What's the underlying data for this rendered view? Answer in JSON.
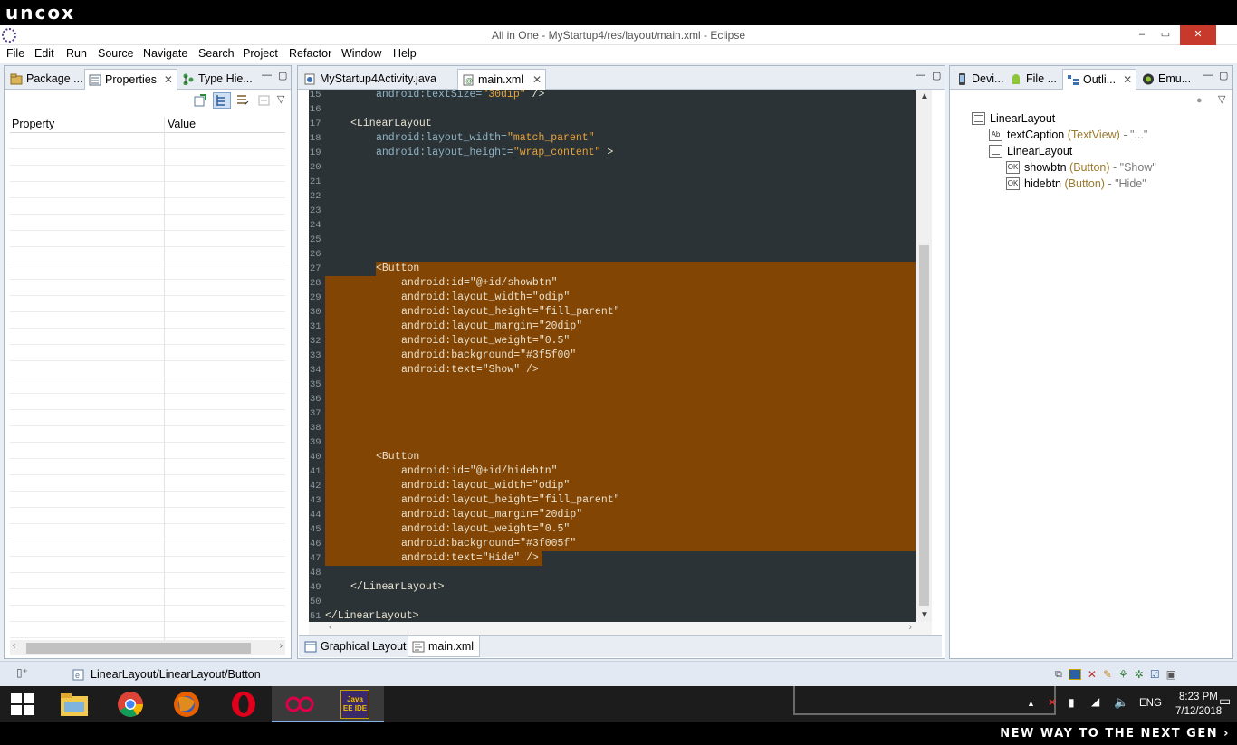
{
  "brand": {
    "logo_text": "uncox",
    "banner": "NEW WAY TO THE NEXT GEN ›"
  },
  "window": {
    "title": "All in One - MyStartup4/res/layout/main.xml - Eclipse",
    "minimize": "–",
    "maximize": "▭",
    "close": "✕"
  },
  "menu": [
    "File",
    "Edit",
    "Run",
    "Source",
    "Navigate",
    "Search",
    "Project",
    "Refactor",
    "Window",
    "Help"
  ],
  "left_panel": {
    "tabs": [
      {
        "label": "Package ...",
        "active": false
      },
      {
        "label": "Properties",
        "active": true
      },
      {
        "label": "Type Hie...",
        "active": false
      }
    ],
    "columns": [
      "Property",
      "Value"
    ]
  },
  "editor": {
    "tabs": [
      {
        "label": "MyStartup4Activity.java",
        "active": false
      },
      {
        "label": "main.xml",
        "active": true
      }
    ],
    "lines": [
      {
        "n": "15",
        "indent": 2,
        "segs": [
          [
            "attr",
            "android:textSize="
          ],
          [
            "str",
            "\"30dip\""
          ],
          [
            "plain",
            " />"
          ]
        ]
      },
      {
        "n": "16",
        "indent": 0,
        "segs": []
      },
      {
        "n": "17",
        "indent": 1,
        "segs": [
          [
            "plain",
            "<LinearLayout"
          ]
        ]
      },
      {
        "n": "18",
        "indent": 2,
        "segs": [
          [
            "attr",
            "android:layout_width="
          ],
          [
            "str",
            "\"match_parent\""
          ]
        ]
      },
      {
        "n": "19",
        "indent": 2,
        "segs": [
          [
            "attr",
            "android:layout_height="
          ],
          [
            "str",
            "\"wrap_content\""
          ],
          [
            "plain",
            " >"
          ]
        ]
      },
      {
        "n": "20",
        "indent": 0,
        "segs": []
      },
      {
        "n": "21",
        "indent": 0,
        "segs": []
      },
      {
        "n": "22",
        "indent": 0,
        "segs": []
      },
      {
        "n": "23",
        "indent": 0,
        "segs": []
      },
      {
        "n": "24",
        "indent": 0,
        "segs": []
      },
      {
        "n": "25",
        "indent": 0,
        "segs": []
      },
      {
        "n": "26",
        "indent": 0,
        "segs": []
      },
      {
        "n": "27",
        "indent": 2,
        "segs": [
          [
            "plain",
            "<Button"
          ]
        ]
      },
      {
        "n": "28",
        "indent": 3,
        "segs": [
          [
            "plain",
            "android:id=\"@+id/showbtn\""
          ]
        ]
      },
      {
        "n": "29",
        "indent": 3,
        "segs": [
          [
            "plain",
            "android:layout_width=\"odip\""
          ]
        ]
      },
      {
        "n": "30",
        "indent": 3,
        "segs": [
          [
            "plain",
            "android:layout_height=\"fill_parent\""
          ]
        ]
      },
      {
        "n": "31",
        "indent": 3,
        "segs": [
          [
            "plain",
            "android:layout_margin=\"20dip\""
          ]
        ]
      },
      {
        "n": "32",
        "indent": 3,
        "segs": [
          [
            "plain",
            "android:layout_weight=\"0.5\""
          ]
        ]
      },
      {
        "n": "33",
        "indent": 3,
        "segs": [
          [
            "plain",
            "android:background=\"#3f5f00\""
          ]
        ]
      },
      {
        "n": "34",
        "indent": 3,
        "segs": [
          [
            "plain",
            "android:text=\"Show\" />"
          ]
        ]
      },
      {
        "n": "35",
        "indent": 0,
        "segs": []
      },
      {
        "n": "36",
        "indent": 0,
        "segs": []
      },
      {
        "n": "37",
        "indent": 0,
        "segs": []
      },
      {
        "n": "38",
        "indent": 0,
        "segs": []
      },
      {
        "n": "39",
        "indent": 0,
        "segs": []
      },
      {
        "n": "40",
        "indent": 2,
        "segs": [
          [
            "plain",
            "<Button"
          ]
        ]
      },
      {
        "n": "41",
        "indent": 3,
        "segs": [
          [
            "plain",
            "android:id=\"@+id/hidebtn\""
          ]
        ]
      },
      {
        "n": "42",
        "indent": 3,
        "segs": [
          [
            "plain",
            "android:layout_width=\"odip\""
          ]
        ]
      },
      {
        "n": "43",
        "indent": 3,
        "segs": [
          [
            "plain",
            "android:layout_height=\"fill_parent\""
          ]
        ]
      },
      {
        "n": "44",
        "indent": 3,
        "segs": [
          [
            "plain",
            "android:layout_margin=\"20dip\""
          ]
        ]
      },
      {
        "n": "45",
        "indent": 3,
        "segs": [
          [
            "plain",
            "android:layout_weight=\"0.5\""
          ]
        ]
      },
      {
        "n": "46",
        "indent": 3,
        "segs": [
          [
            "plain",
            "android:background=\"#3f005f\""
          ]
        ]
      },
      {
        "n": "47",
        "indent": 3,
        "segs": [
          [
            "plain",
            "android:text=\"Hide\" />"
          ]
        ]
      },
      {
        "n": "48",
        "indent": 0,
        "segs": []
      },
      {
        "n": "49",
        "indent": 1,
        "segs": [
          [
            "plain",
            "</LinearLayout>"
          ]
        ]
      },
      {
        "n": "50",
        "indent": 0,
        "segs": []
      },
      {
        "n": "51",
        "indent": 0,
        "segs": [
          [
            "plain",
            "</LinearLayout>"
          ]
        ]
      }
    ],
    "bottom_tabs": [
      {
        "label": "Graphical Layout",
        "active": false
      },
      {
        "label": "main.xml",
        "active": true
      }
    ]
  },
  "right_panel": {
    "tabs": [
      {
        "label": "Devi...",
        "active": false
      },
      {
        "label": "File ...",
        "active": false
      },
      {
        "label": "Outli...",
        "active": true
      },
      {
        "label": "Emu...",
        "active": false
      }
    ],
    "tree": [
      {
        "level": 0,
        "icon": "",
        "name": "LinearLayout",
        "type": "",
        "text": ""
      },
      {
        "level": 1,
        "icon": "Ab",
        "name": "textCaption",
        "type": "(TextView)",
        "text": "- \"...\""
      },
      {
        "level": 1,
        "icon": "",
        "name": "LinearLayout",
        "type": "",
        "text": ""
      },
      {
        "level": 2,
        "icon": "OK",
        "name": "showbtn",
        "type": "(Button)",
        "text": "- \"Show\""
      },
      {
        "level": 2,
        "icon": "OK",
        "name": "hidebtn",
        "type": "(Button)",
        "text": "- \"Hide\""
      }
    ]
  },
  "status": {
    "path": "LinearLayout/LinearLayout/Button"
  },
  "taskbar": {
    "apps": [
      "windows-start",
      "file-explorer",
      "chrome",
      "firefox",
      "opera",
      "media-player",
      "eclipse"
    ],
    "active": "eclipse",
    "eclipse_label": "Java EE IDE",
    "language": "ENG",
    "time": "8:23 PM",
    "date": "7/12/2018"
  },
  "colors": {
    "editor_bg": "#2b3336",
    "selection": "#834503",
    "attr": "#8fb4c7",
    "string": "#e8a23a",
    "plain": "#e8e2d0"
  }
}
